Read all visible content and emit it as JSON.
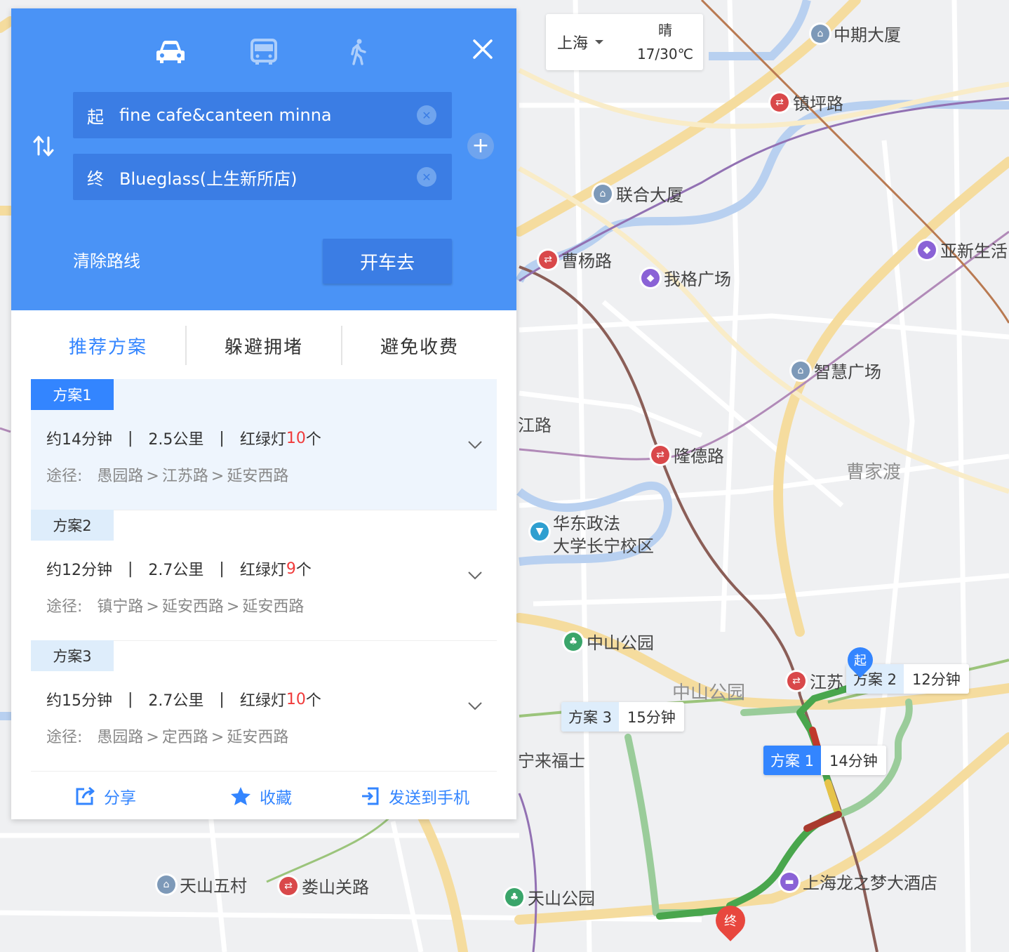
{
  "map": {
    "area_labels": [
      "曹家渡",
      "中山公园"
    ],
    "road_labels": [
      "江路",
      "宁来福士"
    ],
    "pois": [
      {
        "name": "中期大厦",
        "type": "bldg"
      },
      {
        "name": "镇坪路",
        "type": "metro"
      },
      {
        "name": "联合大厦",
        "type": "bldg"
      },
      {
        "name": "曹杨路",
        "type": "metro"
      },
      {
        "name": "我格广场",
        "type": "shop"
      },
      {
        "name": "亚新生活",
        "type": "shop"
      },
      {
        "name": "智慧广场",
        "type": "bldg"
      },
      {
        "name": "隆德路",
        "type": "metro"
      },
      {
        "name": "华东政法大学长宁校区",
        "type": "school"
      },
      {
        "name": "中山公园",
        "type": "park"
      },
      {
        "name": "江苏",
        "type": "metro"
      },
      {
        "name": "天山五村",
        "type": "bldg"
      },
      {
        "name": "娄山关路",
        "type": "metro"
      },
      {
        "name": "天山公园",
        "type": "park"
      },
      {
        "name": "上海龙之梦大酒店",
        "type": "hotel"
      }
    ],
    "school_line1": "华东政法",
    "school_line2": "大学长宁校区",
    "route_tags": [
      {
        "name": "方案 2",
        "time": "12分钟"
      },
      {
        "name": "方案 3",
        "time": "15分钟"
      },
      {
        "name": "方案 1",
        "time": "14分钟"
      }
    ],
    "start_marker": "起",
    "end_marker": "终"
  },
  "weather": {
    "city": "上海",
    "condition": "晴",
    "temp": "17/30℃"
  },
  "panel": {
    "modes": [
      "car-icon",
      "bus-icon",
      "walk-icon"
    ],
    "start": {
      "tag": "起",
      "value": "fine cafe&canteen minna"
    },
    "end": {
      "tag": "终",
      "value": "Blueglass(上生新所店)"
    },
    "clear_route": "清除路线",
    "drive_button": "开车去",
    "tabs": [
      "推荐方案",
      "躲避拥堵",
      "避免收费"
    ],
    "plans": [
      {
        "label": "方案1",
        "time": "约14分钟",
        "distance": "2.5公里",
        "lights_prefix": "红绿灯",
        "lights": "10",
        "lights_suffix": "个",
        "via_label": "途径:",
        "via": [
          "愚园路",
          "江苏路",
          "延安西路"
        ]
      },
      {
        "label": "方案2",
        "time": "约12分钟",
        "distance": "2.7公里",
        "lights_prefix": "红绿灯",
        "lights": "9",
        "lights_suffix": "个",
        "via_label": "途径:",
        "via": [
          "镇宁路",
          "延安西路",
          "延安西路"
        ]
      },
      {
        "label": "方案3",
        "time": "约15分钟",
        "distance": "2.7公里",
        "lights_prefix": "红绿灯",
        "lights": "10",
        "lights_suffix": "个",
        "via_label": "途径:",
        "via": [
          "愚园路",
          "定西路",
          "延安西路"
        ]
      }
    ],
    "actions": [
      "分享",
      "收藏",
      "发送到手机"
    ],
    "colors": {
      "header": "#4a93f6",
      "accent": "#3385ff",
      "lights": "#f03a3a"
    }
  }
}
